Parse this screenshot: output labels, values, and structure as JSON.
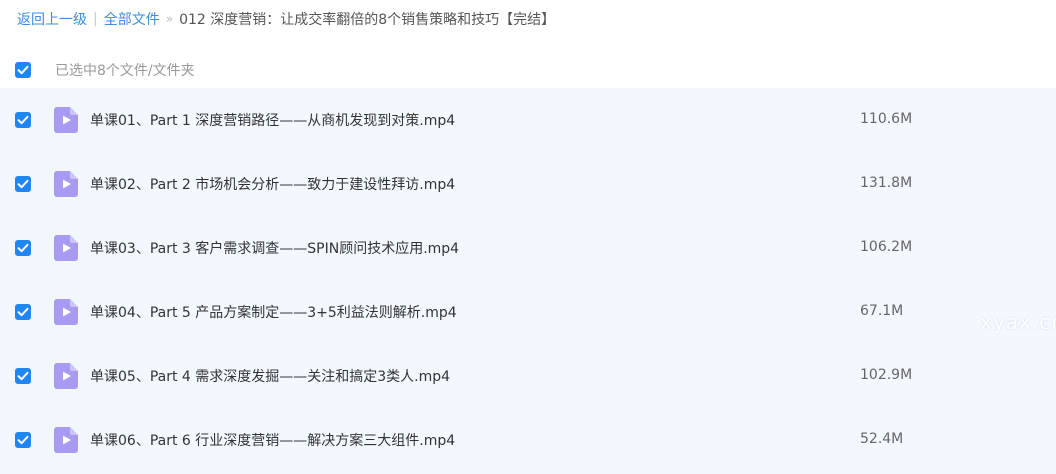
{
  "breadcrumb": {
    "back": "返回上一级",
    "separator": "|",
    "root": "全部文件",
    "arrow": "»",
    "current": "012 深度营销：让成交率翻倍的8个销售策略和技巧【完结】"
  },
  "selection": {
    "checked": true,
    "text": "已选中8个文件/文件夹"
  },
  "files": [
    {
      "name": "单课01、Part 1 深度营销路径——从商机发现到对策.mp4",
      "size": "110.6M",
      "checked": true
    },
    {
      "name": "单课02、Part 2 市场机会分析——致力于建设性拜访.mp4",
      "size": "131.8M",
      "checked": true
    },
    {
      "name": "单课03、Part 3 客户需求调查——SPIN顾问技术应用.mp4",
      "size": "106.2M",
      "checked": true
    },
    {
      "name": "单课04、Part 5 产品方案制定——3+5利益法则解析.mp4",
      "size": "67.1M",
      "checked": true
    },
    {
      "name": "单课05、Part 4 需求深度发掘——关注和搞定3类人.mp4",
      "size": "102.9M",
      "checked": true
    },
    {
      "name": "单课06、Part 6 行业深度营销——解决方案三大组件.mp4",
      "size": "52.4M",
      "checked": true
    }
  ],
  "watermark": "xyax.cn",
  "icons": {
    "checkbox": "checkbox-checked-icon",
    "file": "video-file-icon"
  },
  "colors": {
    "accent": "#1f86f5",
    "link": "#3a8ee6",
    "selected_row_bg": "#f3f8fe",
    "video_icon": "#a99af2"
  }
}
